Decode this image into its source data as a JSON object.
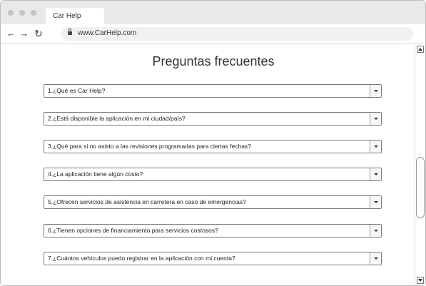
{
  "browser": {
    "tab_title": "Car Help",
    "url": "www.CarHelp.com",
    "back_icon": "arrow-left",
    "forward_icon": "arrow-right",
    "reload_icon": "reload"
  },
  "page": {
    "title": "Preguntas frecuentes",
    "faqs": [
      {
        "text": "1.¿Qué es Car Help?"
      },
      {
        "text": "2.¿Está disponible la aplicación en mi ciudad/país?"
      },
      {
        "text": "3.¿Qué para si no asisto a las revisiones programadas para ciertas fechas?"
      },
      {
        "text": "4.¿La aplicación tiene algún costo?"
      },
      {
        "text": "5.¿Ofrecen servicios de asistencia en carretera en caso de emergencias?"
      },
      {
        "text": "6.¿Tienen opciones de financiamiento para servicios costosos?"
      },
      {
        "text": "7.¿Cuántos vehículos puedo registrar en la aplicación con mi cuenta?"
      }
    ]
  }
}
